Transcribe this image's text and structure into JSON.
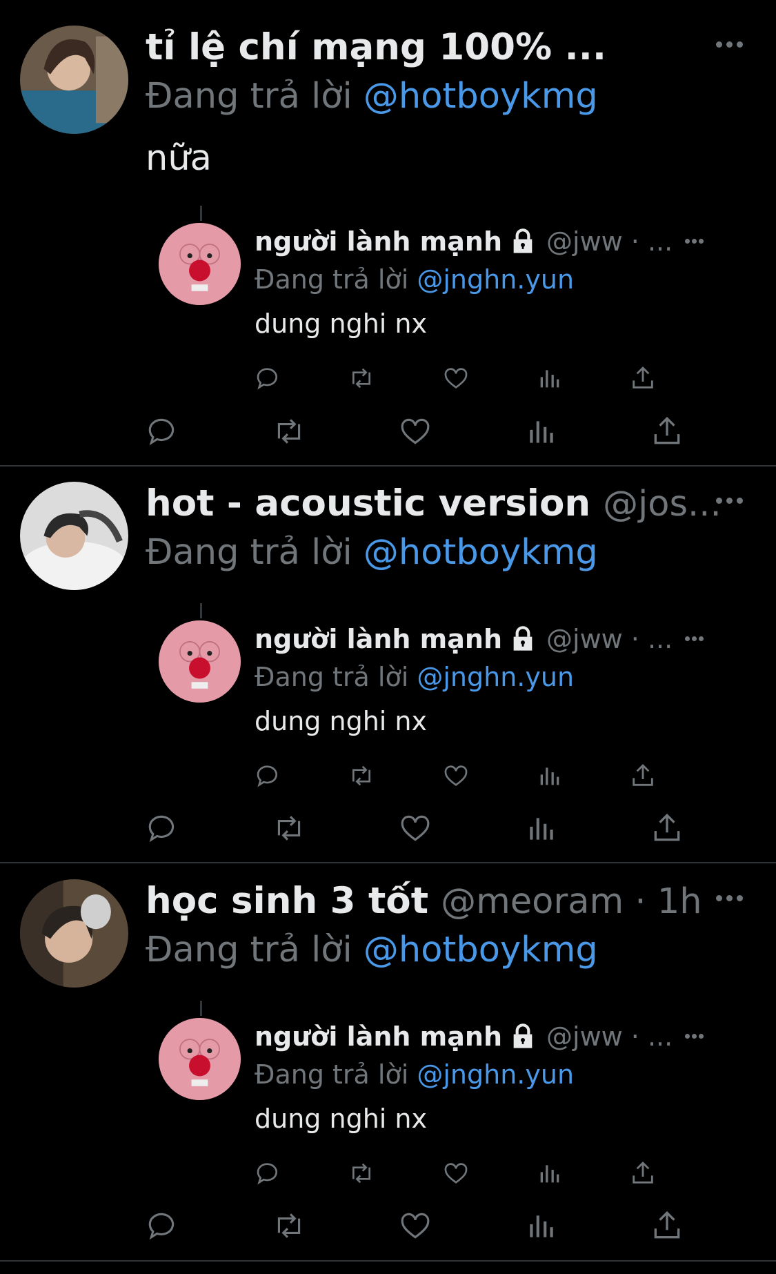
{
  "tweets": [
    {
      "name": "tỉ lệ chí mạng 100% ...",
      "handle": "",
      "reply_prefix": "Đang trả lời",
      "reply_to": "@hotboykmg",
      "text": "nữa",
      "quote": {
        "name": "người lành mạnh",
        "handle": "@jww · ...",
        "reply_prefix": "Đang trả lời",
        "reply_to": "@jnghn.yun",
        "text": "dung nghi nx"
      }
    },
    {
      "name": "hot - acoustic version",
      "handle": "@jos...",
      "reply_prefix": "Đang trả lời",
      "reply_to": "@hotboykmg",
      "text": "",
      "quote": {
        "name": "người lành mạnh",
        "handle": "@jww · ...",
        "reply_prefix": "Đang trả lời",
        "reply_to": "@jnghn.yun",
        "text": "dung nghi nx"
      }
    },
    {
      "name": "học sinh 3 tốt",
      "handle": "@meoram · 1h",
      "reply_prefix": "Đang trả lời",
      "reply_to": "@hotboykmg",
      "text": "",
      "quote": {
        "name": "người lành mạnh",
        "handle": "@jww · ...",
        "reply_prefix": "Đang trả lời",
        "reply_to": "@jnghn.yun",
        "text": "dung nghi nx"
      }
    }
  ],
  "icons": {
    "more": "more-icon",
    "reply": "reply-icon",
    "retweet": "retweet-icon",
    "like": "like-icon",
    "views": "views-icon",
    "share": "share-icon",
    "lock": "lock-icon"
  },
  "colors": {
    "background": "#000000",
    "text": "#e7e9ea",
    "muted": "#71767b",
    "mention": "#4a99e9",
    "divider": "#2f3336"
  }
}
